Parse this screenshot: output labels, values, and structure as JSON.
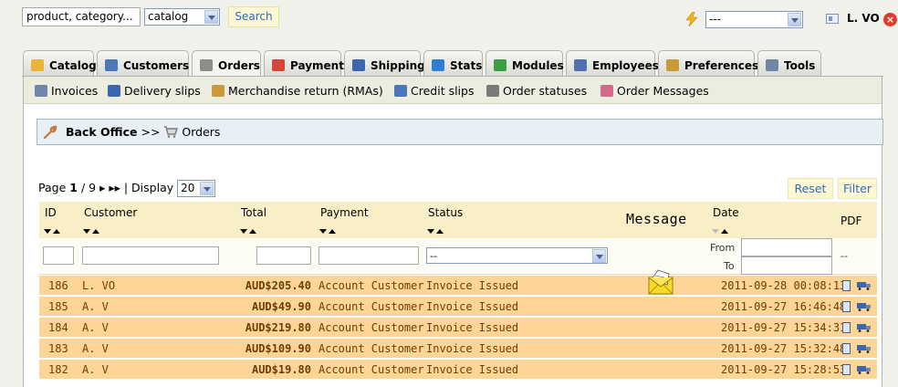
{
  "topbar": {
    "search_value": "product, category...",
    "search_scope": "catalog",
    "search_button": "Search",
    "quick_access": "---",
    "user_name": "L. VO"
  },
  "tabs": [
    {
      "label": "Catalog",
      "color": "#e8b43c"
    },
    {
      "label": "Customers",
      "color": "#4a78b8"
    },
    {
      "label": "Orders",
      "color": "#8c8c8c"
    },
    {
      "label": "Payment",
      "color": "#d9443a"
    },
    {
      "label": "Shipping",
      "color": "#3b66b0"
    },
    {
      "label": "Stats",
      "color": "#2d7fd6"
    },
    {
      "label": "Modules",
      "color": "#3aa043"
    },
    {
      "label": "Employees",
      "color": "#5070b0"
    },
    {
      "label": "Preferences",
      "color": "#c89a3a"
    },
    {
      "label": "Tools",
      "color": "#6f86a8"
    }
  ],
  "active_tab": "Orders",
  "submenu": [
    {
      "label": "Invoices",
      "color": "#6f86a8"
    },
    {
      "label": "Delivery slips",
      "color": "#3b66b0"
    },
    {
      "label": "Merchandise return (RMAs)",
      "color": "#c89a3a"
    },
    {
      "label": "Credit slips",
      "color": "#4a78b8"
    },
    {
      "label": "Order statuses",
      "color": "#7a7a7a"
    },
    {
      "label": "Order Messages",
      "color": "#d46a8a"
    }
  ],
  "breadcrumb": {
    "root": "Back Office",
    "sep": ">>",
    "current": "Orders"
  },
  "pager": {
    "page_label": "Page",
    "current": "1",
    "total": "/ 9",
    "display_label": "| Display",
    "per_page": "20"
  },
  "buttons": {
    "reset": "Reset",
    "filter": "Filter"
  },
  "table": {
    "headers": {
      "id": "ID",
      "customer": "Customer",
      "total": "Total",
      "payment": "Payment",
      "status": "Status",
      "message": "Message",
      "date": "Date",
      "pdf": "PDF"
    },
    "filters": {
      "status_value": "--",
      "from_label": "From",
      "to_label": "To",
      "pdf_value": "--"
    },
    "rows": [
      {
        "id": "186",
        "customer": "L. VO",
        "total": "AUD$205.40",
        "payment": "Account Customer",
        "status": "Invoice Issued",
        "date": "2011-09-28 00:08:13",
        "has_message": true
      },
      {
        "id": "185",
        "customer": "A. V",
        "total": "AUD$49.90",
        "payment": "Account Customer",
        "status": "Invoice Issued",
        "date": "2011-09-27 16:46:48",
        "has_message": false
      },
      {
        "id": "184",
        "customer": "A. V",
        "total": "AUD$219.80",
        "payment": "Account Customer",
        "status": "Invoice Issued",
        "date": "2011-09-27 15:34:31",
        "has_message": false
      },
      {
        "id": "183",
        "customer": "A. V",
        "total": "AUD$109.90",
        "payment": "Account Customer",
        "status": "Invoice Issued",
        "date": "2011-09-27 15:32:48",
        "has_message": false
      },
      {
        "id": "182",
        "customer": "A. V",
        "total": "AUD$19.80",
        "payment": "Account Customer",
        "status": "Invoice Issued",
        "date": "2011-09-27 15:28:53",
        "has_message": false
      }
    ]
  }
}
